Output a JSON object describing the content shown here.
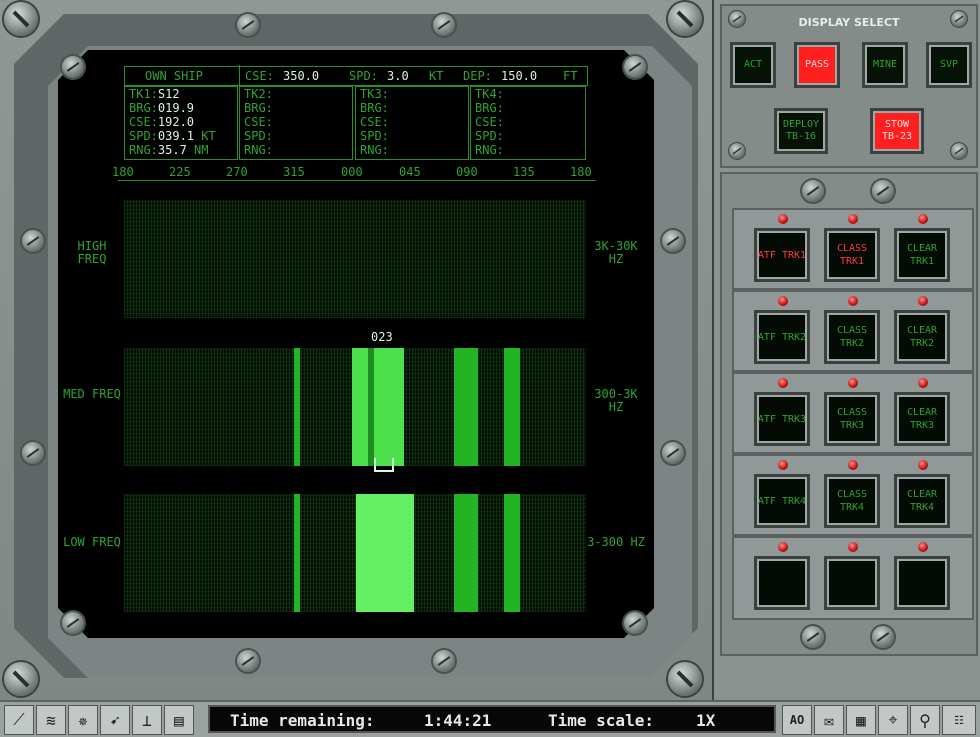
{
  "own_ship": {
    "label": "OWN SHIP",
    "cse_label": "CSE:",
    "cse": "350.0",
    "spd_label": "SPD:",
    "spd": "3.0",
    "spd_unit": "KT",
    "dep_label": "DEP:",
    "dep": "150.0",
    "dep_unit": "FT"
  },
  "tracks": [
    {
      "name": "TK1:",
      "id": "S12",
      "brg": "019.9",
      "cse": "192.0",
      "spd": "039.1",
      "spd_unit": "KT",
      "rng": "35.7",
      "rng_unit": "NM"
    },
    {
      "name": "TK2:"
    },
    {
      "name": "TK3:"
    },
    {
      "name": "TK4:"
    }
  ],
  "field_labels": {
    "brg": "BRG:",
    "cse": "CSE:",
    "spd": "SPD:",
    "rng": "RNG:"
  },
  "bearing_ticks": [
    "180",
    "225",
    "270",
    "315",
    "000",
    "045",
    "090",
    "135",
    "180"
  ],
  "marker_label": "023",
  "bands": [
    {
      "left": "HIGH FREQ",
      "right": "3K-30K HZ"
    },
    {
      "left": "MED FREQ",
      "right": "300-3K HZ"
    },
    {
      "left": "LOW FREQ",
      "right": "3-300 HZ"
    }
  ],
  "display_select": {
    "title": "DISPLAY SELECT",
    "buttons": [
      {
        "label": "ACT",
        "active": false
      },
      {
        "label": "PASS",
        "active": true
      },
      {
        "label": "MINE",
        "active": false
      },
      {
        "label": "SVP",
        "active": false
      }
    ],
    "deploy_label": "DEPLOY TB-16",
    "stow_label": "STOW TB-23"
  },
  "track_controls": [
    {
      "atf": "ATF TRK1",
      "class": "CLASS TRK1",
      "clear": "CLEAR TRK1"
    },
    {
      "atf": "ATF TRK2",
      "class": "CLASS TRK2",
      "clear": "CLEAR TRK2"
    },
    {
      "atf": "ATF TRK3",
      "class": "CLASS TRK3",
      "clear": "CLEAR TRK3"
    },
    {
      "atf": "ATF TRK4",
      "class": "CLASS TRK4",
      "clear": "CLEAR TRK4"
    }
  ],
  "status": {
    "time_remaining_label": "Time remaining:",
    "time_remaining": "1:44:21",
    "time_scale_label": "Time scale:",
    "time_scale": "1X"
  },
  "toolbar_right": {
    "ao_label": "AO"
  },
  "colors": {
    "phosphor": "#2fa42f",
    "active": "#ff1f1f"
  }
}
